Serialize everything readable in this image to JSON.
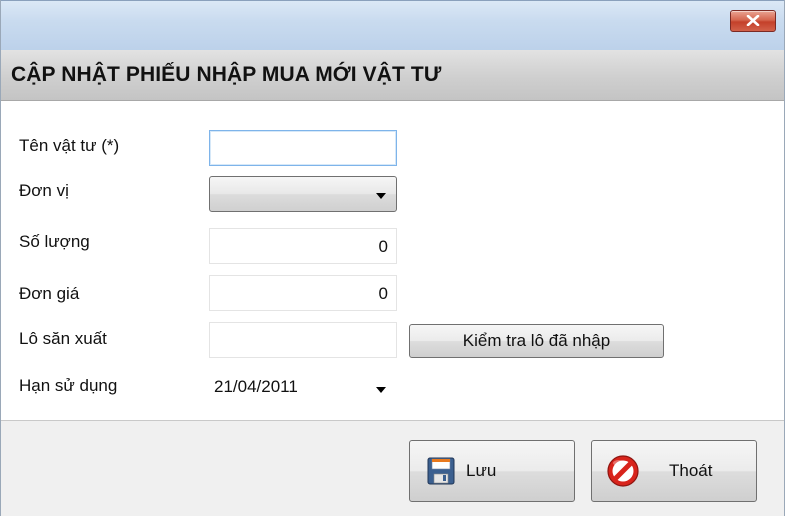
{
  "window": {
    "header_title": "CẬP NHẬT PHIẾU NHẬP MUA MỚI VẬT TƯ",
    "close_icon": "close-icon"
  },
  "form": {
    "material_name": {
      "label": "Tên vật tư (*)",
      "value": ""
    },
    "unit": {
      "label": "Đơn vị",
      "value": ""
    },
    "quantity": {
      "label": "Số lượng",
      "value": "0"
    },
    "unit_price": {
      "label": "Đơn giá",
      "value": "0"
    },
    "batch": {
      "label": "Lô săn xuất",
      "value": ""
    },
    "expiry": {
      "label": "Hạn sử dụng",
      "value": "21/04/2011"
    },
    "check_batch_button": "Kiểm tra lô đã nhập"
  },
  "actions": {
    "save_label": "Lưu",
    "save_icon": "floppy-disk-icon",
    "exit_label": "Thoát",
    "exit_icon": "no-entry-icon"
  },
  "colors": {
    "close_button": "#d6664f",
    "focus_border": "#7eb4ea",
    "exit_icon_red": "#d8241c"
  }
}
